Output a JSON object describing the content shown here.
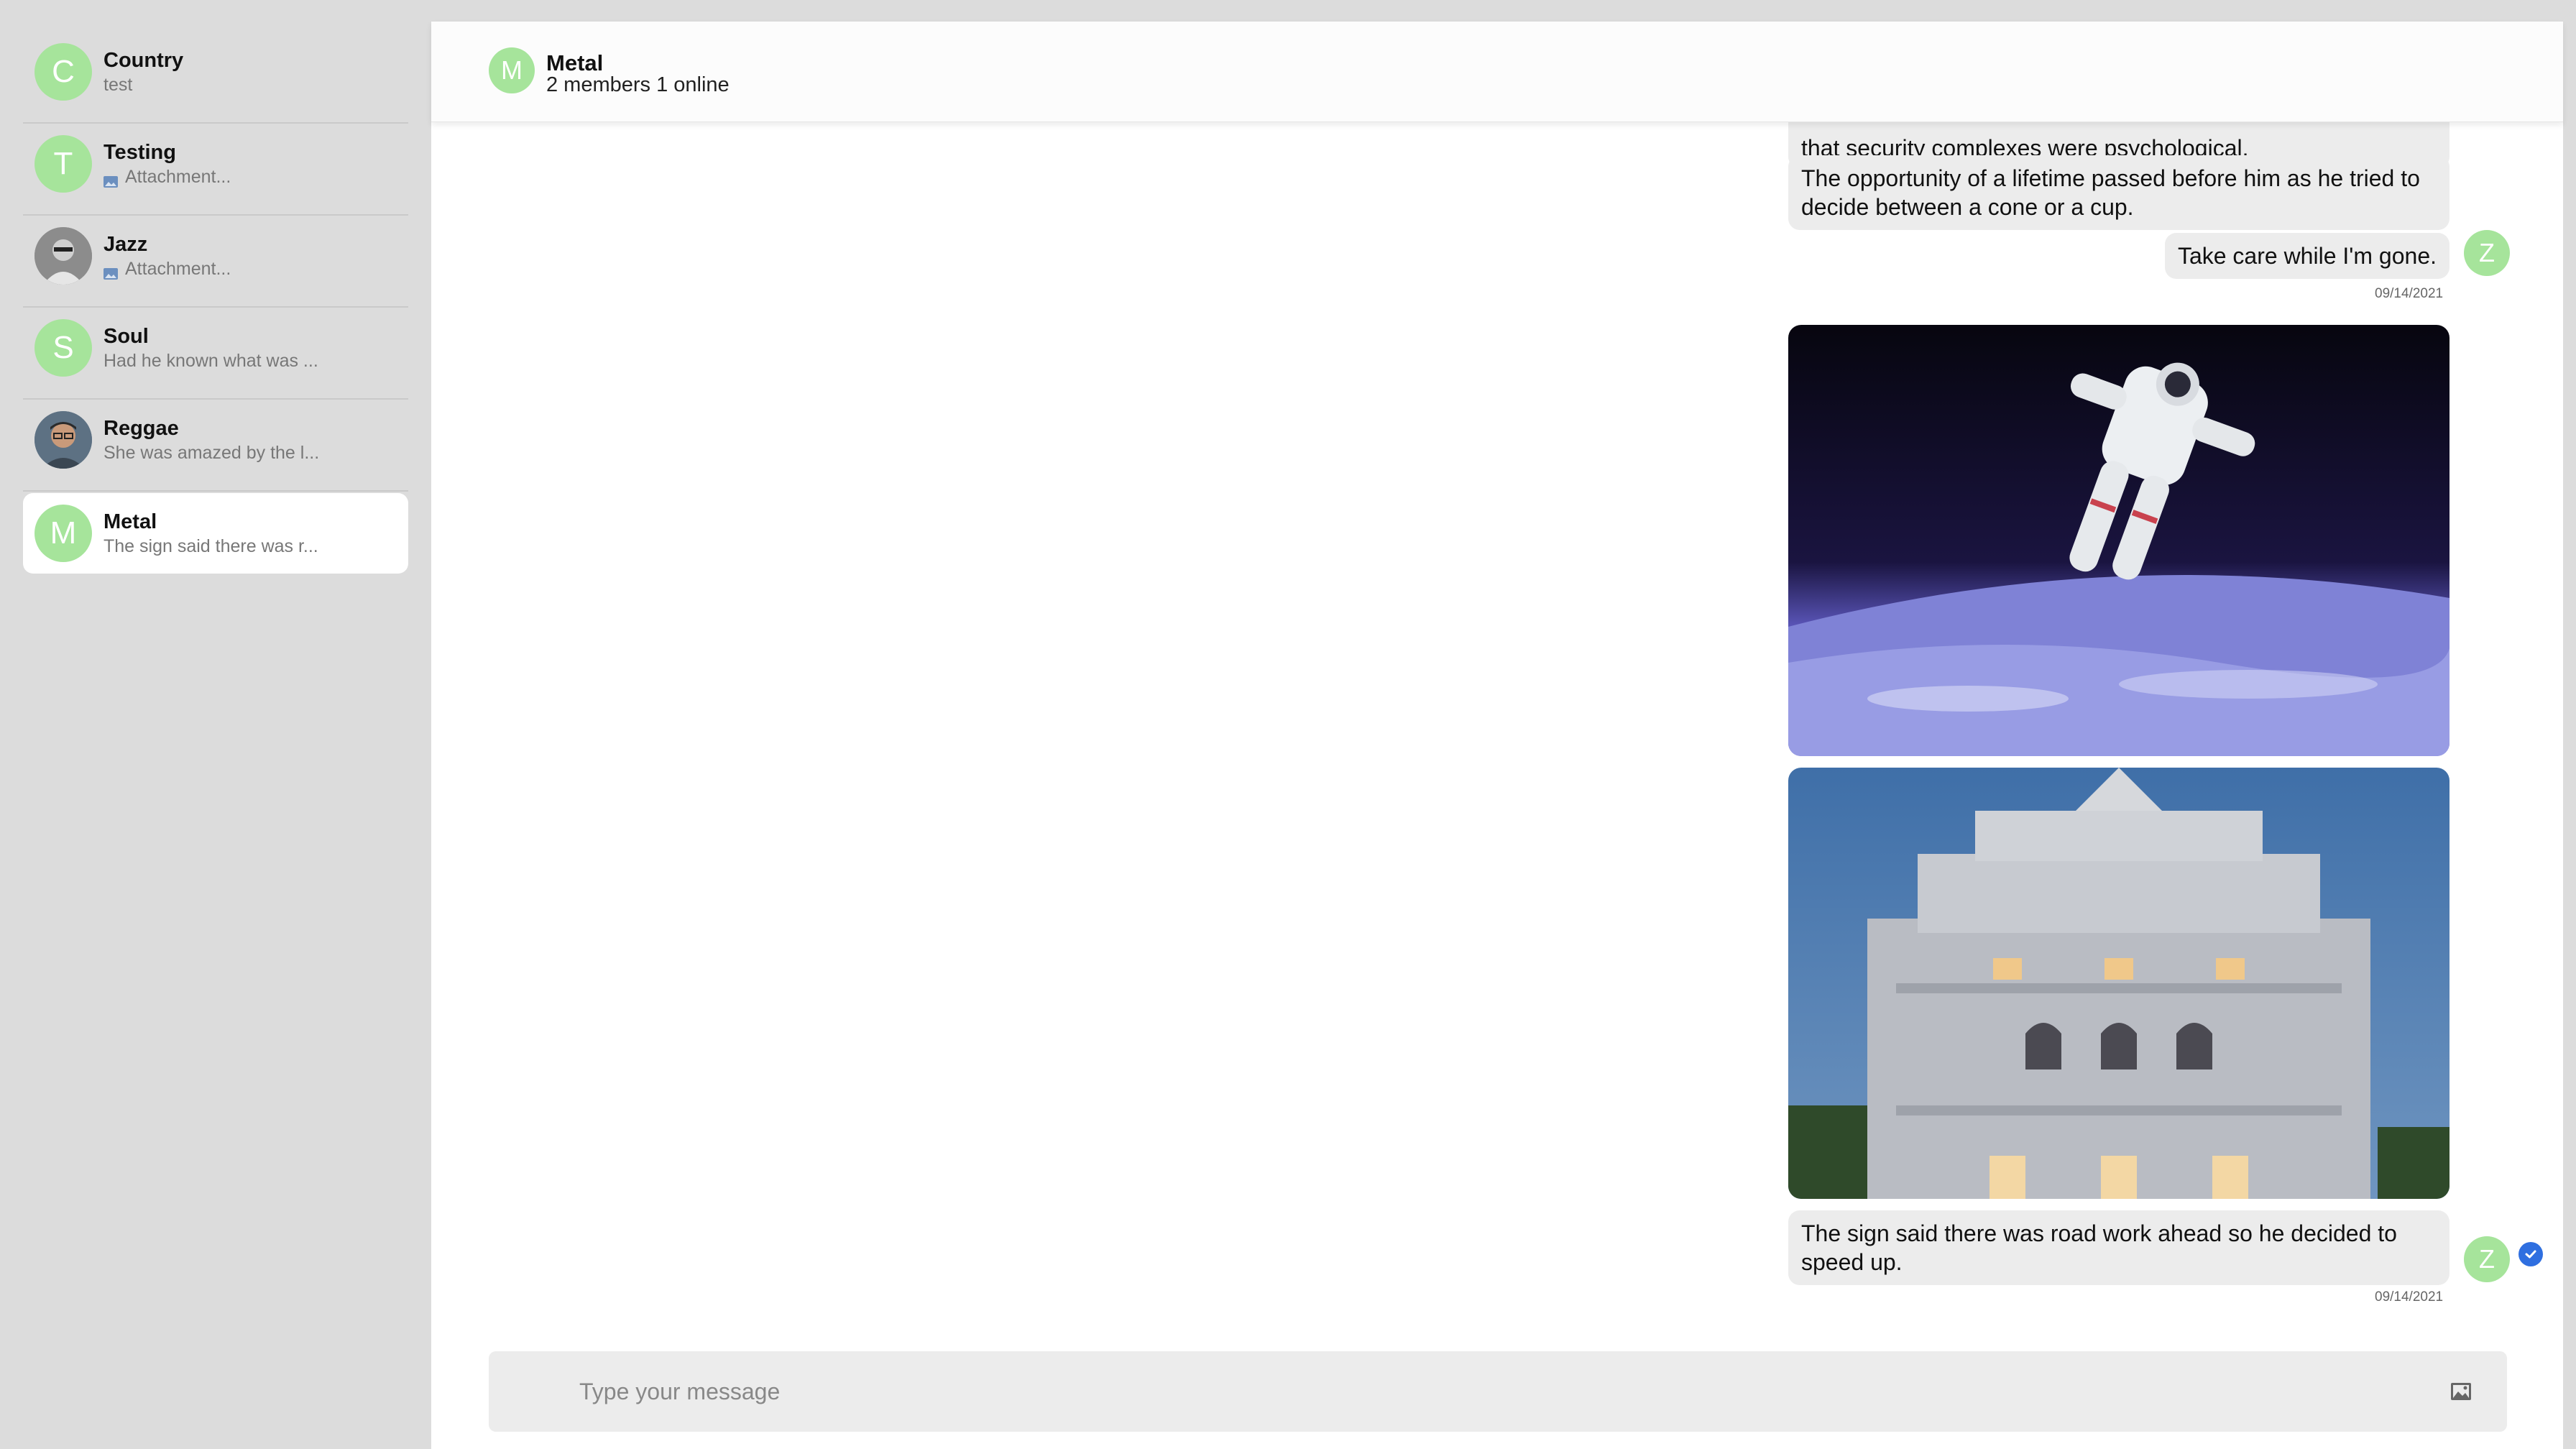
{
  "sidebar": {
    "conversations": [
      {
        "initial": "C",
        "name": "Country",
        "preview": "test",
        "attachment": false
      },
      {
        "initial": "T",
        "name": "Testing",
        "preview": "Attachment...",
        "attachment": true
      },
      {
        "initial": "",
        "name": "Jazz",
        "preview": "Attachment...",
        "attachment": true,
        "photo": "person-grayscale-avatar"
      },
      {
        "initial": "S",
        "name": "Soul",
        "preview": "Had he known what was ...",
        "attachment": false
      },
      {
        "initial": "",
        "name": "Reggae",
        "preview": "She was amazed by the l...",
        "attachment": false,
        "photo": "person-glasses-avatar"
      },
      {
        "initial": "M",
        "name": "Metal",
        "preview": "The sign said there was r...",
        "attachment": false,
        "active": true
      }
    ]
  },
  "header": {
    "initial": "M",
    "title": "Metal",
    "subtitle": "2 members 1 online"
  },
  "messages": {
    "partial_text": "that security complexes were psychological.",
    "msg1": "The opportunity of a lifetime passed before him as he tried to decide between a cone or a cup.",
    "msg2": "Take care while I'm gone.",
    "timestamp1": "09/14/2021",
    "image1": "astronaut-over-earth-photo",
    "image2": "ornate-theater-building-photo",
    "msg3": "The sign said there was road work ahead so he decided to speed up.",
    "timestamp2": "09/14/2021",
    "sender_initial": "Z"
  },
  "composer": {
    "placeholder": "Type your message",
    "attach_icon": "image-icon"
  },
  "colors": {
    "avatar_green": "#a6e49b",
    "bubble_gray": "#ececec",
    "read_blue": "#2f6fe0"
  }
}
